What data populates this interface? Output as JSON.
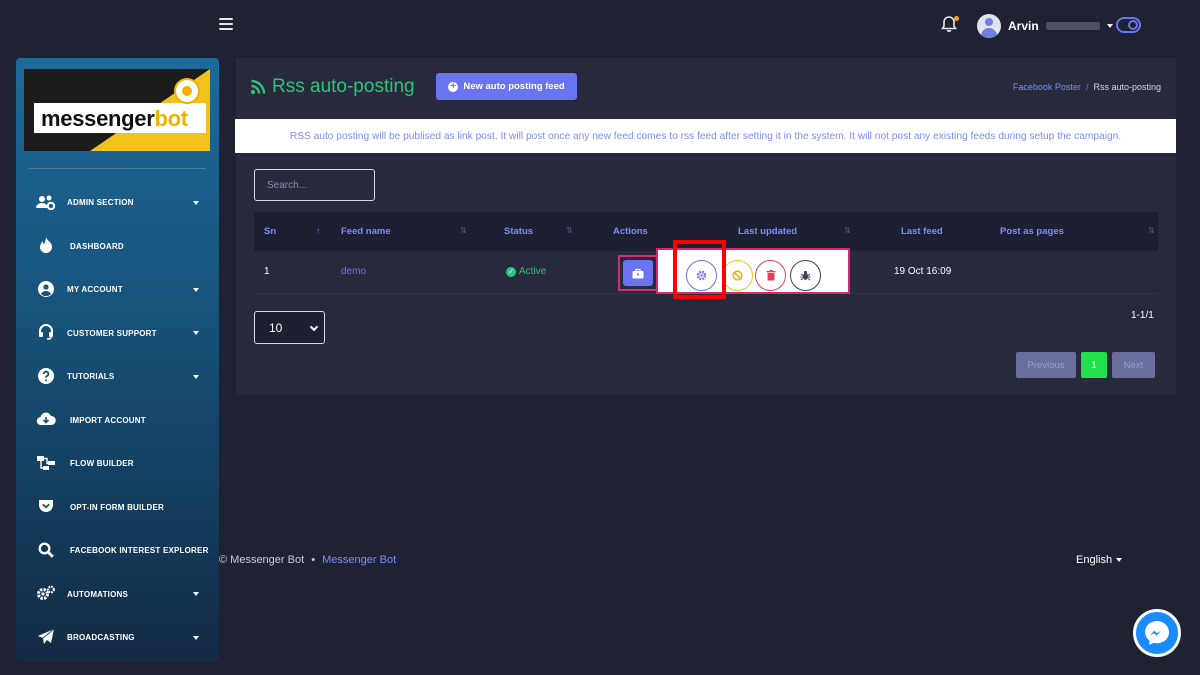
{
  "topbar": {
    "user_name": "Arvin"
  },
  "sidebar": {
    "logo_text_1": "messenger",
    "logo_text_2": "bot",
    "items": [
      {
        "label": "ADMIN SECTION",
        "icon": "users-cog-icon",
        "has_caret": true
      },
      {
        "label": "DASHBOARD",
        "icon": "fire-icon",
        "has_caret": false
      },
      {
        "label": "MY ACCOUNT",
        "icon": "user-circle-icon",
        "has_caret": true
      },
      {
        "label": "CUSTOMER SUPPORT",
        "icon": "headset-icon",
        "has_caret": true
      },
      {
        "label": "TUTORIALS",
        "icon": "question-circle-icon",
        "has_caret": true
      },
      {
        "label": "IMPORT ACCOUNT",
        "icon": "cloud-download-icon",
        "has_caret": false
      },
      {
        "label": "FLOW BUILDER",
        "icon": "sitemap-icon",
        "has_caret": false
      },
      {
        "label": "OPT-IN FORM BUILDER",
        "icon": "pocket-icon",
        "has_caret": false
      },
      {
        "label": "FACEBOOK INTEREST EXPLORER",
        "icon": "search-icon",
        "has_caret": false
      },
      {
        "label": "AUTOMATIONS",
        "icon": "cogs-icon",
        "has_caret": true
      },
      {
        "label": "BROADCASTING",
        "icon": "paper-plane-icon",
        "has_caret": true
      }
    ]
  },
  "header": {
    "title": "Rss auto-posting",
    "new_button": "New auto posting feed",
    "breadcrumb_parent": "Facebook Poster",
    "breadcrumb_current": "Rss auto-posting"
  },
  "info": "RSS auto posting will be publised as link post. It will post once any new feed comes to rss feed after setting it in the system. It will not post any existing feeds during setup the campaign.",
  "search": {
    "placeholder": "Search..."
  },
  "table": {
    "headers": {
      "sn": "Sn",
      "feed_name": "Feed name",
      "status": "Status",
      "actions": "Actions",
      "last_updated": "Last updated",
      "last_feed": "Last feed",
      "post_as_pages": "Post as pages"
    },
    "rows": [
      {
        "sn": "1",
        "feed_name": "demo",
        "status": "Active",
        "last_feed": "19 Oct 16:09",
        "post_as_pages": ""
      }
    ]
  },
  "pagination": {
    "page_size": "10",
    "count": "1-1/1",
    "previous": "Previous",
    "current": "1",
    "next": "Next"
  },
  "footer": {
    "copyright": "© Messenger Bot",
    "bullet": "•",
    "link": "Messenger Bot",
    "language": "English"
  },
  "colors": {
    "accent": "#6a73f0",
    "success": "#2bc37a",
    "highlight": "#ff0000",
    "active_page": "#21e24a"
  }
}
